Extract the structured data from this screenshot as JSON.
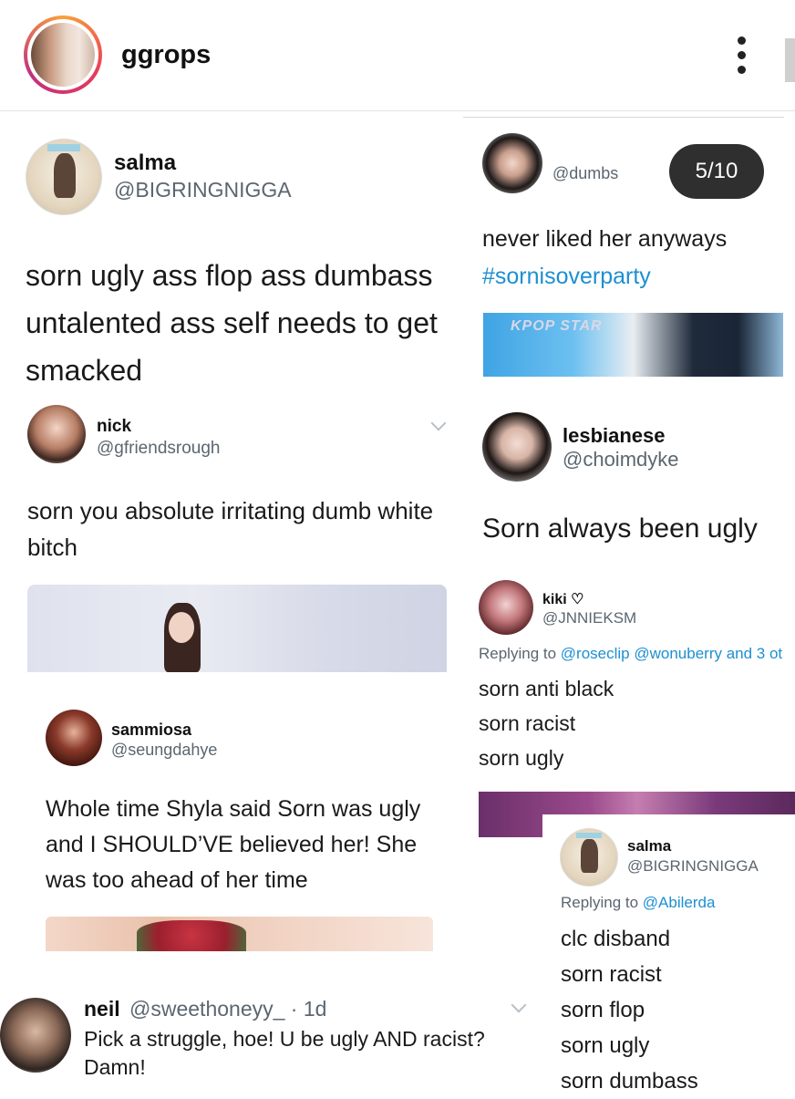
{
  "header": {
    "username": "ggrops",
    "pager": "5/10"
  },
  "tweets": {
    "salma1": {
      "name": "salma",
      "handle": "@BIGRINGNIGGA",
      "text_lines": [
        "sorn ugly ass flop ass dumbass",
        "untalented ass self needs to get",
        "smacked"
      ]
    },
    "nick": {
      "name": "nick",
      "handle": "@gfriendsrough",
      "text_lines": [
        "sorn you absolute irritating dumb white",
        "bitch"
      ]
    },
    "sammiosa": {
      "name": "sammiosa",
      "handle": "@seungdahye",
      "text_lines": [
        "Whole time Shyla said Sorn was ugly",
        "and I SHOULD’VE believed her! She",
        "was too ahead of her time"
      ]
    },
    "neil": {
      "name": "neil",
      "handle_time": "@sweethoneyy_ · 1d",
      "text_lines": [
        "Pick a struggle, hoe! U be ugly AND racist?",
        "Damn!"
      ]
    },
    "dumbs": {
      "handle": "@dumbs",
      "text": "never liked her anyways",
      "hashtag": "#sornisoverparty",
      "image_text": "KPOP STAR"
    },
    "lesbianese": {
      "name": "lesbianese",
      "handle": "@choimdyke",
      "text": "Sorn always been ugly"
    },
    "kiki": {
      "name": "kiki ♡",
      "handle": "@JNNIEKSM",
      "replying_prefix": "Replying to",
      "replying_to": "@roseclip @wonuberry and 3 ot",
      "lines": [
        "sorn anti black",
        "sorn racist",
        "sorn ugly"
      ]
    },
    "salma2": {
      "name": "salma",
      "handle": "@BIGRINGNIGGA",
      "replying_prefix": "Replying to",
      "replying_to": "@Abilerda",
      "lines": [
        "clc disband",
        "sorn racist",
        "sorn flop",
        "sorn ugly",
        "sorn dumbass"
      ]
    }
  },
  "colors": {
    "link_blue": "#1d8fd1",
    "handle_gray": "#5b6670",
    "pager_bg": "#2f2f2f"
  }
}
